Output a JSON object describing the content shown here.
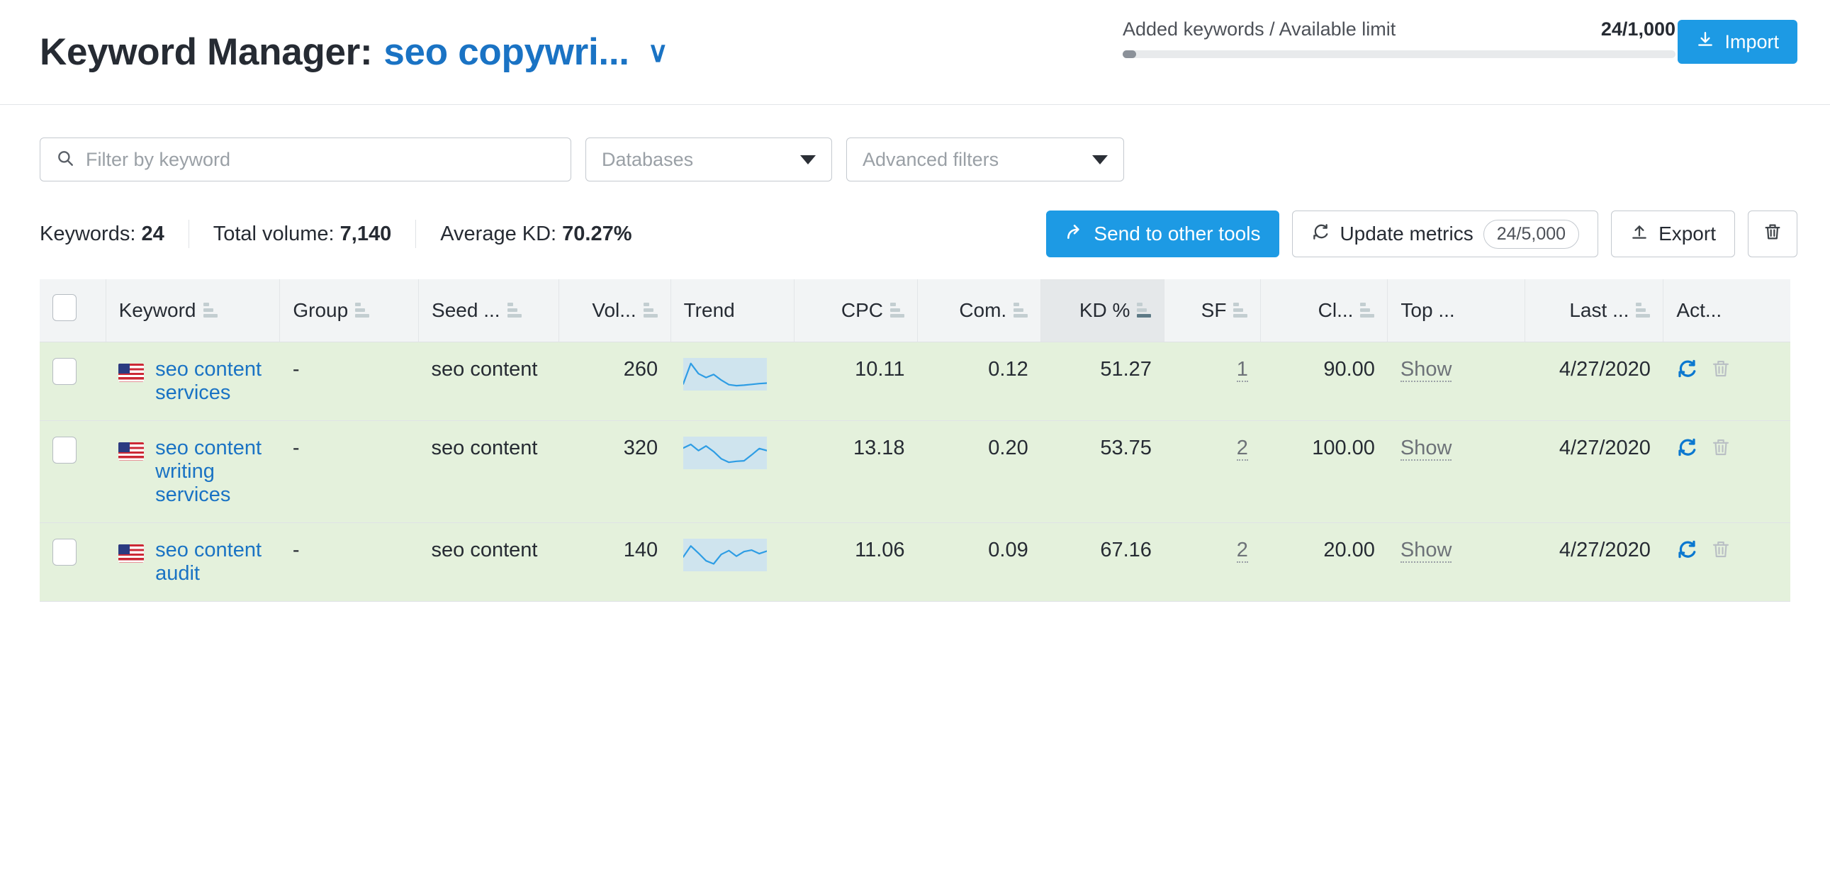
{
  "header": {
    "title_prefix": "Keyword Manager:",
    "project_name": "seo copywri...",
    "caret": "∨",
    "limit_label": "Added keywords / Available limit",
    "limit_value": "24/1,000",
    "limit_percent": 2.4,
    "import_label": "Import",
    "accent_color": "#1d9ae4"
  },
  "filters": {
    "search_placeholder": "Filter by keyword",
    "search_value": "",
    "databases_label": "Databases",
    "advanced_label": "Advanced filters"
  },
  "stats": {
    "keywords_label": "Keywords:",
    "keywords_value": "24",
    "volume_label": "Total volume:",
    "volume_value": "7,140",
    "kd_label": "Average KD:",
    "kd_value": "70.27%"
  },
  "toolbar": {
    "send_label": "Send to other tools",
    "update_label": "Update metrics",
    "update_count": "24/5,000",
    "export_label": "Export",
    "delete_label": ""
  },
  "table": {
    "columns": [
      {
        "key": "check",
        "label": "",
        "sortable": false,
        "sorted": false,
        "align": "left"
      },
      {
        "key": "keyword",
        "label": "Keyword",
        "sortable": true,
        "sorted": false,
        "align": "left"
      },
      {
        "key": "group",
        "label": "Group",
        "sortable": true,
        "sorted": false,
        "align": "left"
      },
      {
        "key": "seed",
        "label": "Seed ...",
        "sortable": true,
        "sorted": false,
        "align": "left"
      },
      {
        "key": "volume",
        "label": "Vol...",
        "sortable": true,
        "sorted": false,
        "align": "right"
      },
      {
        "key": "trend",
        "label": "Trend",
        "sortable": false,
        "sorted": false,
        "align": "left"
      },
      {
        "key": "cpc",
        "label": "CPC",
        "sortable": true,
        "sorted": false,
        "align": "right"
      },
      {
        "key": "com",
        "label": "Com.",
        "sortable": true,
        "sorted": false,
        "align": "right"
      },
      {
        "key": "kd",
        "label": "KD %",
        "sortable": true,
        "sorted": true,
        "align": "right"
      },
      {
        "key": "sf",
        "label": "SF",
        "sortable": true,
        "sorted": false,
        "align": "right"
      },
      {
        "key": "clicks",
        "label": "Cl...",
        "sortable": true,
        "sorted": false,
        "align": "right"
      },
      {
        "key": "top",
        "label": "Top ...",
        "sortable": false,
        "sorted": false,
        "align": "left"
      },
      {
        "key": "last",
        "label": "Last ...",
        "sortable": true,
        "sorted": false,
        "align": "right"
      },
      {
        "key": "actions",
        "label": "Act...",
        "sortable": false,
        "sorted": false,
        "align": "left"
      }
    ],
    "rows": [
      {
        "checked": false,
        "flag": "us-flag-icon",
        "keyword": "seo content services",
        "group": "-",
        "seed": "seo content",
        "volume": "260",
        "trend": [
          0.15,
          0.95,
          0.55,
          0.4,
          0.52,
          0.3,
          0.12,
          0.08,
          0.1,
          0.13,
          0.16,
          0.18
        ],
        "cpc": "10.11",
        "com": "0.12",
        "kd": "51.27",
        "sf": "1",
        "clicks": "90.00",
        "top": "Show",
        "last": "4/27/2020",
        "refresh": "refresh-icon",
        "delete": "trash-icon"
      },
      {
        "checked": false,
        "flag": "us-flag-icon",
        "keyword": "seo content writing services",
        "group": "-",
        "seed": "seo content",
        "volume": "320",
        "trend": [
          0.72,
          0.86,
          0.62,
          0.8,
          0.58,
          0.3,
          0.16,
          0.2,
          0.22,
          0.45,
          0.7,
          0.62
        ],
        "cpc": "13.18",
        "com": "0.20",
        "kd": "53.75",
        "sf": "2",
        "clicks": "100.00",
        "top": "Show",
        "last": "4/27/2020",
        "refresh": "refresh-icon",
        "delete": "trash-icon"
      },
      {
        "checked": false,
        "flag": "us-flag-icon",
        "keyword": "seo content audit",
        "group": "-",
        "seed": "seo content",
        "volume": "140",
        "trend": [
          0.45,
          0.88,
          0.6,
          0.3,
          0.18,
          0.55,
          0.7,
          0.48,
          0.66,
          0.72,
          0.58,
          0.68
        ],
        "cpc": "11.06",
        "com": "0.09",
        "kd": "67.16",
        "sf": "2",
        "clicks": "20.00",
        "top": "Show",
        "last": "4/27/2020",
        "refresh": "refresh-icon",
        "delete": "trash-icon"
      }
    ]
  }
}
